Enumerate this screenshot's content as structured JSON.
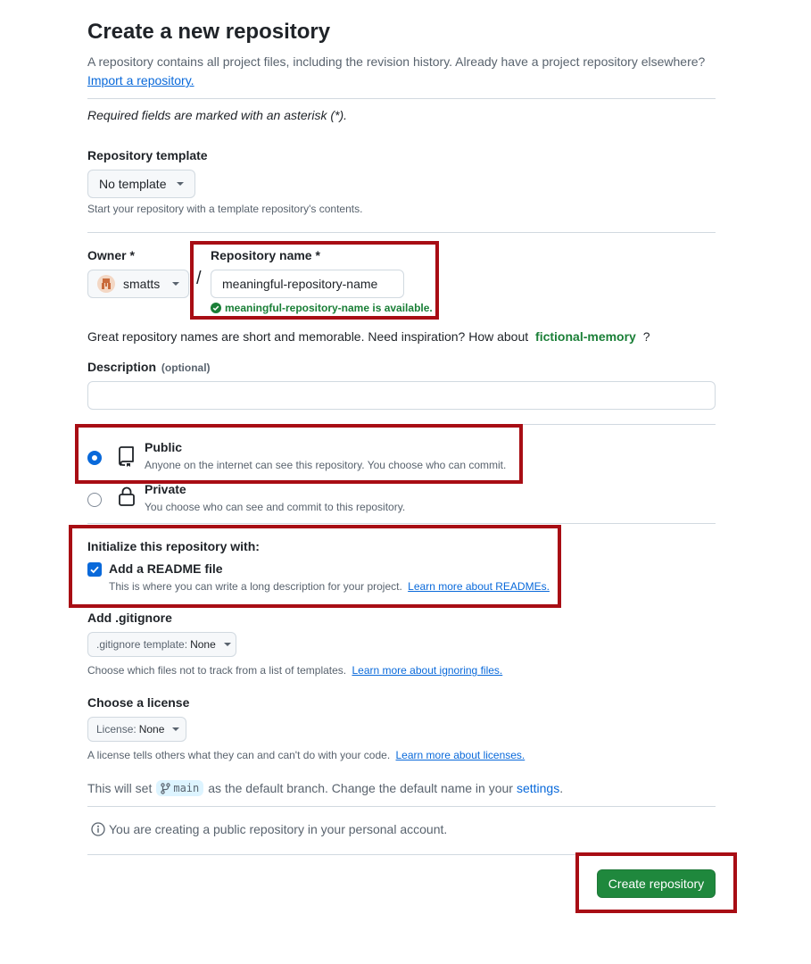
{
  "header": {
    "title": "Create a new repository",
    "subtitle": "A repository contains all project files, including the revision history. Already have a project repository elsewhere?",
    "import_link": "Import a repository."
  },
  "required_note": "Required fields are marked with an asterisk (*).",
  "template": {
    "label": "Repository template",
    "value": "No template",
    "hint": "Start your repository with a template repository's contents."
  },
  "owner": {
    "label": "Owner *",
    "value": "smatts"
  },
  "separator": "/",
  "repo_name": {
    "label": "Repository name *",
    "value": "meaningful-repository-name",
    "availability": "meaningful-repository-name is available."
  },
  "inspiration": {
    "text": "Great repository names are short and memorable. Need inspiration? How about",
    "suggestion": "fictional-memory",
    "end": "?"
  },
  "description": {
    "label": "Description",
    "optional": "(optional)",
    "value": ""
  },
  "visibility": {
    "public": {
      "label": "Public",
      "desc": "Anyone on the internet can see this repository. You choose who can commit.",
      "selected": true
    },
    "private": {
      "label": "Private",
      "desc": "You choose who can see and commit to this repository.",
      "selected": false
    }
  },
  "initialize": {
    "heading": "Initialize this repository with:",
    "readme_label": "Add a README file",
    "readme_checked": true,
    "readme_desc": "This is where you can write a long description for your project.",
    "readme_link": "Learn more about READMEs."
  },
  "gitignore": {
    "label": "Add .gitignore",
    "prefix": ".gitignore template:",
    "value": "None",
    "hint": "Choose which files not to track from a list of templates.",
    "link": "Learn more about ignoring files."
  },
  "license": {
    "label": "Choose a license",
    "prefix": "License:",
    "value": "None",
    "hint": "A license tells others what they can and can't do with your code.",
    "link": "Learn more about licenses."
  },
  "branch": {
    "before": "This will set",
    "name": "main",
    "after": "as the default branch. Change the default name in your",
    "settings_link": "settings",
    "end": "."
  },
  "info_note": "You are creating a public repository in your personal account.",
  "submit": {
    "label": "Create repository"
  },
  "icons": {
    "chevron": "chevron-down-icon",
    "owner_avatar": "avatar",
    "available": "check-circle-icon",
    "public": "repo-icon",
    "private": "lock-icon",
    "checkbox": "checkmark-icon",
    "branch": "git-branch-icon",
    "info": "info-icon"
  },
  "colors": {
    "accent": "#0969da",
    "success": "#1a7f37",
    "primary_button": "#1f883d",
    "annotation": "#a80d14"
  }
}
